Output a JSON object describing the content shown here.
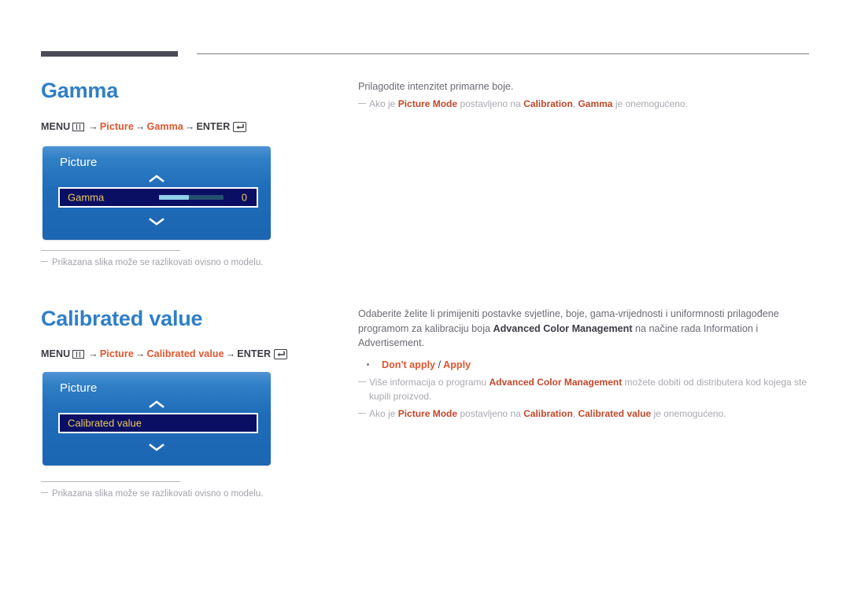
{
  "sections": [
    {
      "heading": "Gamma",
      "menu_path": {
        "menu_label": "MENU",
        "menu_icon": "menu-icon",
        "steps": [
          "Picture",
          "Gamma"
        ],
        "enter_label": "ENTER",
        "enter_icon": "enter-icon",
        "arrow": "→"
      },
      "osd": {
        "title": "Picture",
        "up_icon": "chevron-up-icon",
        "down_icon": "chevron-down-icon",
        "row_label": "Gamma",
        "row_value": "0",
        "has_slider": true
      },
      "footnote": "Prikazana slika može se razlikovati ovisno o modelu.",
      "body": {
        "paragraphs": [
          "Prilagodite intenzitet primarne boje."
        ],
        "bullet": null,
        "notes": [
          {
            "parts": [
              {
                "t": "Ako je ",
                "b": false
              },
              {
                "t": "Picture Mode",
                "b": true
              },
              {
                "t": " postavljeno na ",
                "b": false
              },
              {
                "t": "Calibration",
                "b": true
              },
              {
                "t": ", ",
                "b": false
              },
              {
                "t": "Gamma",
                "b": true
              },
              {
                "t": " je onemogućeno.",
                "b": false
              }
            ]
          }
        ]
      }
    },
    {
      "heading": "Calibrated value",
      "menu_path": {
        "menu_label": "MENU",
        "menu_icon": "menu-icon",
        "steps": [
          "Picture",
          "Calibrated value"
        ],
        "enter_label": "ENTER",
        "enter_icon": "enter-icon",
        "arrow": "→"
      },
      "osd": {
        "title": "Picture",
        "up_icon": "chevron-up-icon",
        "down_icon": "chevron-down-icon",
        "row_label": "Calibrated value",
        "row_value": "",
        "has_slider": false
      },
      "footnote": "Prikazana slika može se razlikovati ovisno o modelu.",
      "body": {
        "paragraphs": [
          "Odaberite želite li primijeniti postavke svjetline, boje, gama-vrijednosti i uniformnosti prilagođene programom za kalibraciju boja <b>Advanced Color Management</b> na načine rada Information i Advertisement."
        ],
        "bullet": {
          "option_a": "Don't apply",
          "separator": "/",
          "option_b": "Apply"
        },
        "notes": [
          {
            "parts": [
              {
                "t": "Više informacija o programu ",
                "b": false
              },
              {
                "t": "Advanced Color Management",
                "b": true
              },
              {
                "t": " možete dobiti od distributera kod kojega ste kupili proizvod.",
                "b": false
              }
            ]
          },
          {
            "parts": [
              {
                "t": "Ako je ",
                "b": false
              },
              {
                "t": "Picture Mode",
                "b": true
              },
              {
                "t": " postavljeno na ",
                "b": false
              },
              {
                "t": "Calibration",
                "b": true
              },
              {
                "t": ", ",
                "b": false
              },
              {
                "t": "Calibrated value",
                "b": true
              },
              {
                "t": " je onemogućeno.",
                "b": false
              }
            ]
          }
        ]
      }
    }
  ],
  "colors": {
    "heading_blue": "#2f7fc6",
    "accent_orange": "#e0552c",
    "note_red": "#c0482a",
    "osd_blue": "#1f6cb8",
    "osd_row_navy": "#0a0f63",
    "osd_row_gold": "#e9c95f",
    "rule_dark": "#4b4b57"
  }
}
